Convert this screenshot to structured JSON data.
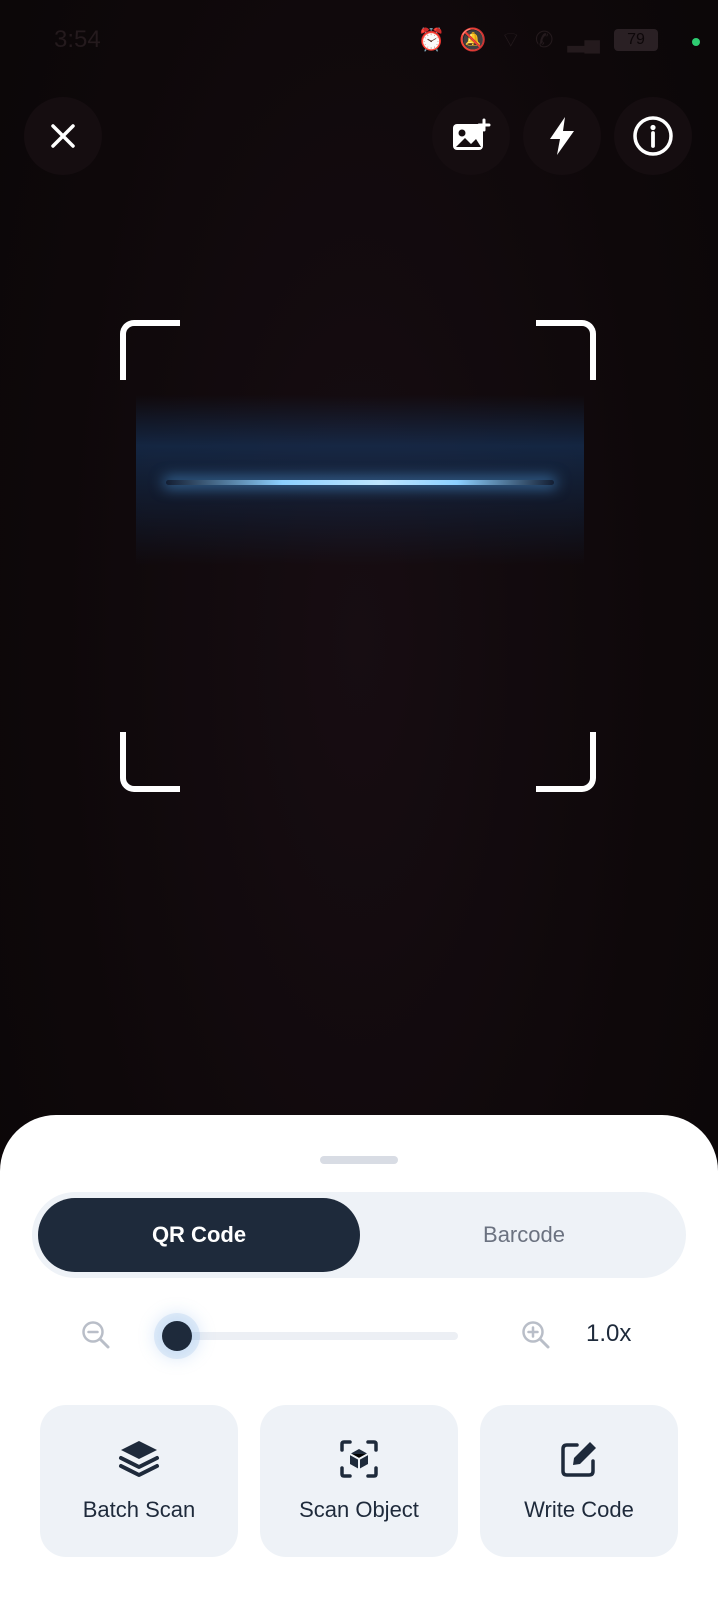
{
  "status_bar": {
    "time": "3:54",
    "battery": "79"
  },
  "top_actions": {
    "close": "close-icon",
    "gallery": "gallery-add-icon",
    "flash": "flash-icon",
    "info": "info-icon"
  },
  "mode_toggle": {
    "active": "QR Code",
    "inactive": "Barcode"
  },
  "zoom": {
    "value_label": "1.0x",
    "level": 0
  },
  "actions": [
    {
      "label": "Batch Scan",
      "icon": "layers-icon"
    },
    {
      "label": "Scan Object",
      "icon": "scan-object-icon"
    },
    {
      "label": "Write Code",
      "icon": "edit-icon"
    }
  ],
  "colors": {
    "accent_dark": "#1e2a3b",
    "scan_line": "#8cd0ff",
    "sheet_bg": "#ffffff",
    "chip_bg": "#eef2f7"
  }
}
